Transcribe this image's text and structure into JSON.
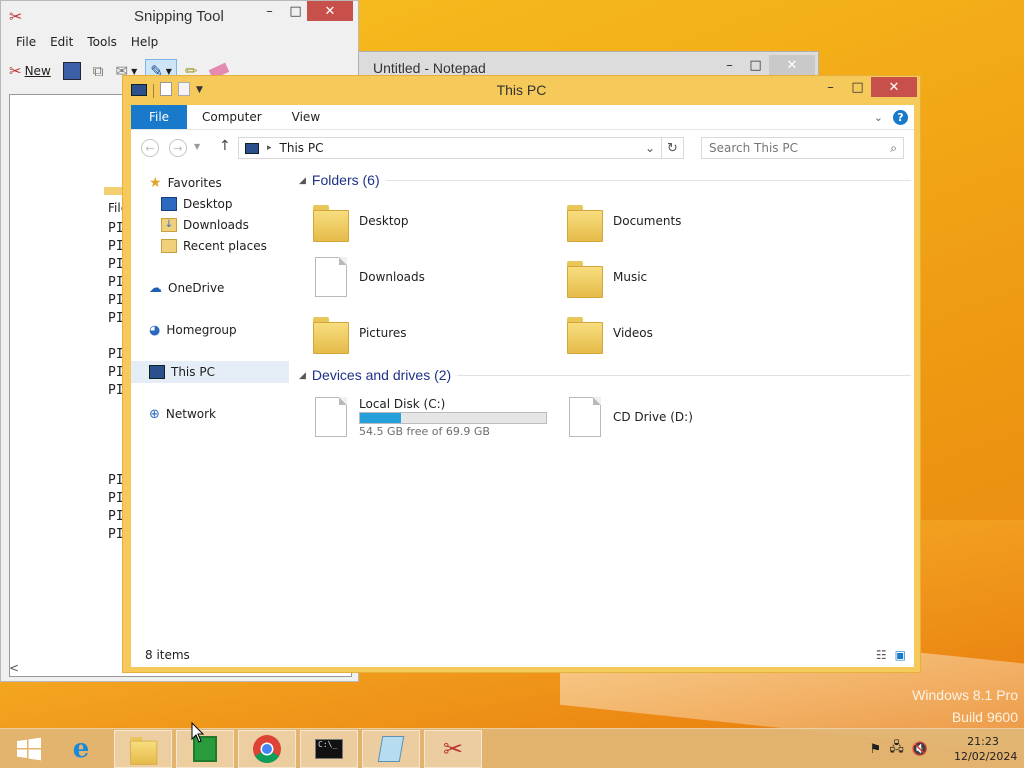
{
  "snipping_tool": {
    "title": "Snipping Tool",
    "menu": [
      "File",
      "Edit",
      "Tools",
      "Help"
    ],
    "new_label": "New",
    "canvas_file_label": "File",
    "canvas_lines": [
      "PI",
      "PI",
      "PI",
      "PI",
      "PI",
      "PI",
      "",
      "PI",
      "PI",
      "PI",
      "",
      "",
      "",
      "",
      "PI",
      "PI",
      "PI",
      "PI"
    ],
    "scroll_left": "<"
  },
  "notepad": {
    "title": "Untitled - Notepad"
  },
  "explorer": {
    "title": "This PC",
    "ribbon": {
      "file": "File",
      "tabs": [
        "Computer",
        "View"
      ]
    },
    "address": "This PC",
    "search_placeholder": "Search This PC",
    "nav": {
      "favorites": "Favorites",
      "desktop": "Desktop",
      "downloads": "Downloads",
      "recent": "Recent places",
      "onedrive": "OneDrive",
      "homegroup": "Homegroup",
      "thispc": "This PC",
      "network": "Network"
    },
    "folders_header": "Folders (6)",
    "folders": [
      "Desktop",
      "Documents",
      "Downloads",
      "Music",
      "Pictures",
      "Videos"
    ],
    "devices_header": "Devices and drives (2)",
    "drives": [
      {
        "name": "Local Disk (C:)",
        "free_text": "54.5 GB free of 69.9 GB",
        "used_fraction": 0.22
      },
      {
        "name": "CD Drive (D:)"
      }
    ],
    "status": "8 items"
  },
  "watermark": {
    "line1": "Windows 8.1 Pro",
    "line2": "Build 9600"
  },
  "taskbar": {
    "time": "21:23",
    "date": "12/02/2024"
  }
}
